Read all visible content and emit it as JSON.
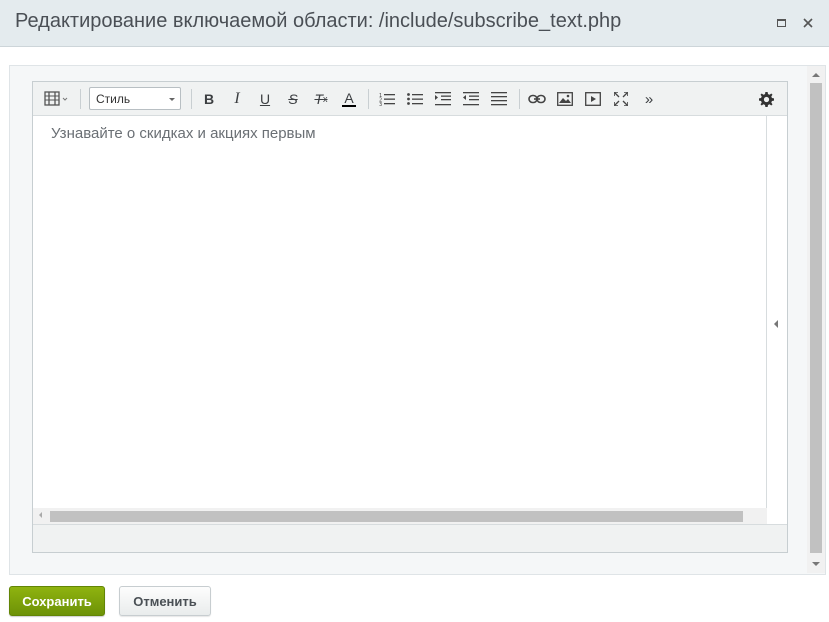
{
  "window": {
    "title": "Редактирование включаемой области: /include/subscribe_text.php"
  },
  "toolbar": {
    "style_select": {
      "value": "Стиль"
    },
    "bold": "B",
    "italic": "I",
    "underline": "U",
    "strikethrough": "S",
    "remove_format": "T",
    "remove_format_sub": "x",
    "font_color": "A",
    "more": "»"
  },
  "editor": {
    "content": "Узнавайте о скидках и акциях первым"
  },
  "buttons": {
    "save": "Сохранить",
    "cancel": "Отменить"
  },
  "colors": {
    "save_bg": "#7ca10b",
    "titlebar_bg": "#e4ebee",
    "toolbar_bg": "#f0f2f2"
  }
}
